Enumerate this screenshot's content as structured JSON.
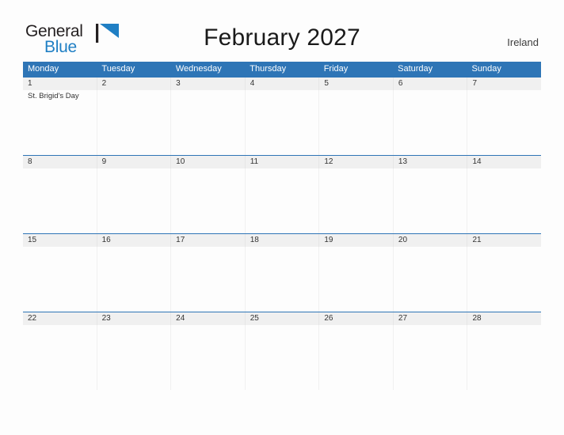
{
  "brand": {
    "line1": "General",
    "line2": "Blue",
    "mark_icon": "blue-flag-triangle-icon",
    "accent_color": "#1f7fc4"
  },
  "header": {
    "title": "February 2027",
    "locale": "Ireland"
  },
  "theme": {
    "header_blue": "#2e75b6",
    "date_strip_gray": "#f0f0f0",
    "page_background": "#fdfdfd",
    "text_color": "#333333"
  },
  "calendar": {
    "weekdays": [
      "Monday",
      "Tuesday",
      "Wednesday",
      "Thursday",
      "Friday",
      "Saturday",
      "Sunday"
    ],
    "weeks": [
      {
        "days": [
          {
            "date": "1",
            "events": [
              "St. Brigid's Day"
            ]
          },
          {
            "date": "2",
            "events": []
          },
          {
            "date": "3",
            "events": []
          },
          {
            "date": "4",
            "events": []
          },
          {
            "date": "5",
            "events": []
          },
          {
            "date": "6",
            "events": []
          },
          {
            "date": "7",
            "events": []
          }
        ]
      },
      {
        "days": [
          {
            "date": "8",
            "events": []
          },
          {
            "date": "9",
            "events": []
          },
          {
            "date": "10",
            "events": []
          },
          {
            "date": "11",
            "events": []
          },
          {
            "date": "12",
            "events": []
          },
          {
            "date": "13",
            "events": []
          },
          {
            "date": "14",
            "events": []
          }
        ]
      },
      {
        "days": [
          {
            "date": "15",
            "events": []
          },
          {
            "date": "16",
            "events": []
          },
          {
            "date": "17",
            "events": []
          },
          {
            "date": "18",
            "events": []
          },
          {
            "date": "19",
            "events": []
          },
          {
            "date": "20",
            "events": []
          },
          {
            "date": "21",
            "events": []
          }
        ]
      },
      {
        "days": [
          {
            "date": "22",
            "events": []
          },
          {
            "date": "23",
            "events": []
          },
          {
            "date": "24",
            "events": []
          },
          {
            "date": "25",
            "events": []
          },
          {
            "date": "26",
            "events": []
          },
          {
            "date": "27",
            "events": []
          },
          {
            "date": "28",
            "events": []
          }
        ]
      }
    ]
  }
}
